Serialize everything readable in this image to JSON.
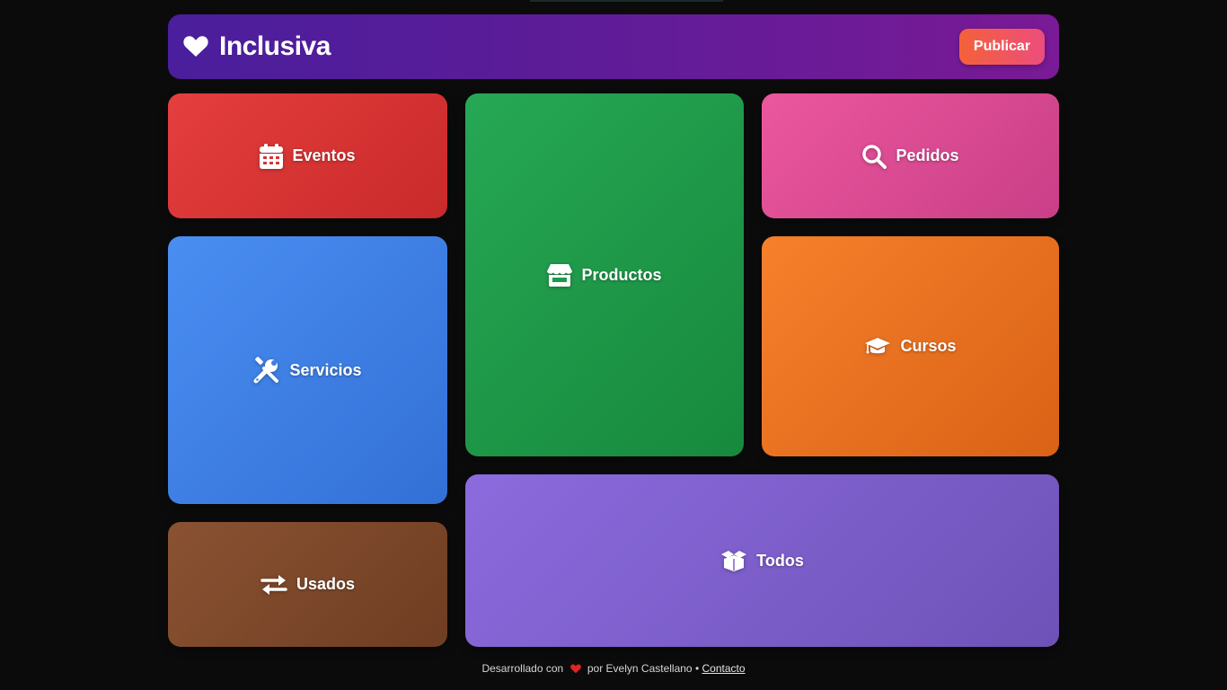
{
  "header": {
    "logo_icon": "heart-icon",
    "title": "Inclusiva",
    "publish_label": "Publicar"
  },
  "tiles": [
    {
      "label": "Eventos",
      "icon": "calendar-icon",
      "color": "#e53e3e"
    },
    {
      "label": "Servicios",
      "icon": "tools-icon",
      "color": "#4a8ef2"
    },
    {
      "label": "Usados",
      "icon": "exchange-icon",
      "color": "#8a5232"
    },
    {
      "label": "Productos",
      "icon": "store-icon",
      "color": "#26a854"
    },
    {
      "label": "Pedidos",
      "icon": "search-icon",
      "color": "#ec579e"
    },
    {
      "label": "Cursos",
      "icon": "graduation-cap-icon",
      "color": "#f6802b"
    },
    {
      "label": "Todos",
      "icon": "box-open-icon",
      "color": "#8c6bde"
    }
  ],
  "footer": {
    "prefix": "Desarrollado con",
    "author": "por Evelyn Castellano",
    "separator": "•",
    "contact_label": "Contacto",
    "heart_color": "#e02424"
  }
}
